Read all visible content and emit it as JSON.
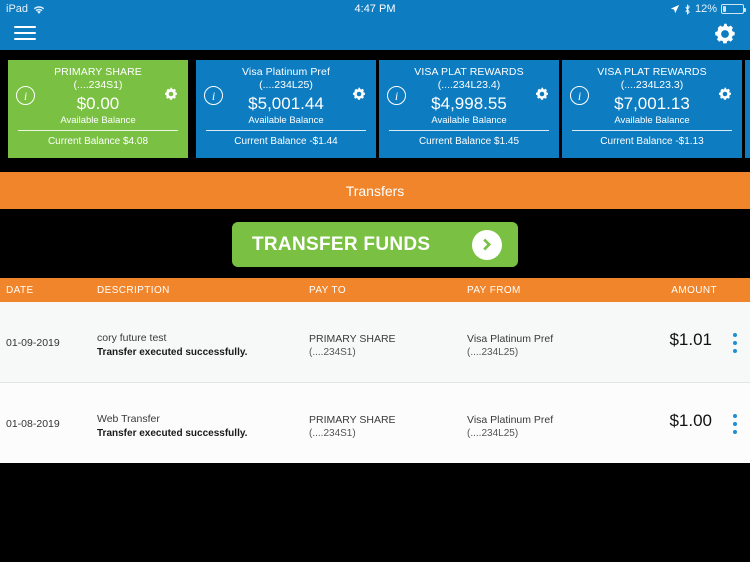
{
  "status_bar": {
    "device": "iPad",
    "wifi_icon": "wifi-icon",
    "time": "4:47 PM",
    "location_icon": "location-arrow-icon",
    "bluetooth_icon": "bluetooth-icon",
    "battery_percent": "12%",
    "battery_level": 12
  },
  "nav_bar": {
    "menu_icon": "hamburger-menu-icon",
    "settings_icon": "gear-icon",
    "background_color": "#0d7cc1"
  },
  "accounts": [
    {
      "name": "PRIMARY SHARE",
      "account_number": "(....234S1)",
      "available_balance": "$0.00",
      "available_label": "Available Balance",
      "current_balance": "Current Balance $4.08",
      "color": "#7ac143",
      "info_icon": "info-icon",
      "gear_icon": "gear-icon"
    },
    {
      "name": "Visa Platinum Pref",
      "account_number": "(....234L25)",
      "available_balance": "$5,001.44",
      "available_label": "Available Balance",
      "current_balance": "Current Balance -$1.44",
      "color": "#0d7cc1",
      "info_icon": "info-icon",
      "gear_icon": "gear-icon"
    },
    {
      "name": "VISA PLAT REWARDS",
      "account_number": "(....234L23.4)",
      "available_balance": "$4,998.55",
      "available_label": "Available Balance",
      "current_balance": "Current Balance $1.45",
      "color": "#0d7cc1",
      "info_icon": "info-icon",
      "gear_icon": "gear-icon"
    },
    {
      "name": "VISA PLAT REWARDS",
      "account_number": "(....234L23.3)",
      "available_balance": "$7,001.13",
      "available_label": "Available Balance",
      "current_balance": "Current Balance -$1.13",
      "color": "#0d7cc1",
      "info_icon": "info-icon",
      "gear_icon": "gear-icon"
    }
  ],
  "section": {
    "title": "Transfers",
    "accent_color": "#f1852b"
  },
  "transfer_button": {
    "label": "TRANSFER FUNDS",
    "arrow_icon": "chevron-right-icon",
    "color": "#7ac143"
  },
  "table": {
    "columns": [
      "DATE",
      "DESCRIPTION",
      "PAY TO",
      "PAY FROM",
      "AMOUNT"
    ],
    "rows": [
      {
        "date": "01-09-2019",
        "description": "cory future test",
        "status": "Transfer executed successfully.",
        "pay_to_name": "PRIMARY SHARE",
        "pay_to_acct": "(....234S1)",
        "pay_from_name": "Visa Platinum Pref",
        "pay_from_acct": "(....234L25)",
        "amount": "$1.01",
        "menu_icon": "kebab-menu-icon"
      },
      {
        "date": "01-08-2019",
        "description": "Web Transfer",
        "status": "Transfer executed successfully.",
        "pay_to_name": "PRIMARY SHARE",
        "pay_to_acct": "(....234S1)",
        "pay_from_name": "Visa Platinum Pref",
        "pay_from_acct": "(....234L25)",
        "amount": "$1.00",
        "menu_icon": "kebab-menu-icon"
      }
    ]
  }
}
